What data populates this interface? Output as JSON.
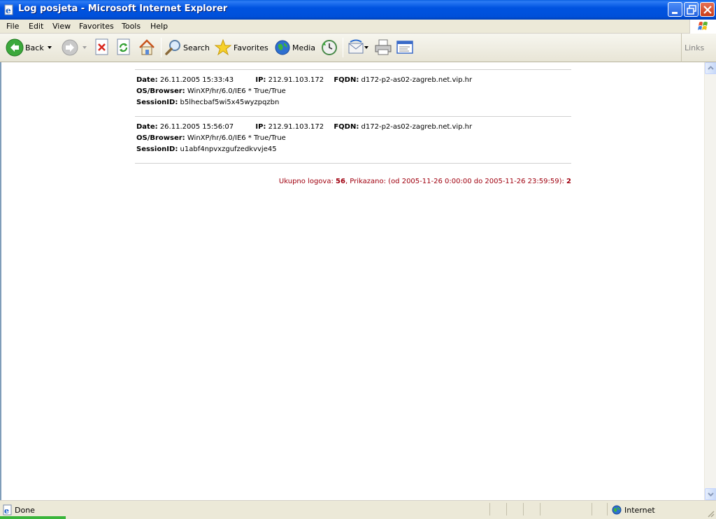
{
  "window": {
    "title": "Log posjeta - Microsoft Internet Explorer"
  },
  "menu": [
    "File",
    "Edit",
    "View",
    "Favorites",
    "Tools",
    "Help"
  ],
  "toolbar": {
    "back_label": "Back",
    "search_label": "Search",
    "favorites_label": "Favorites",
    "media_label": "Media",
    "links_label": "Links"
  },
  "labels": {
    "date": "Date:",
    "ip": "IP:",
    "fqdn": "FQDN:",
    "os_browser": "OS/Browser:",
    "session": "SessionID:"
  },
  "entries": [
    {
      "date": "26.11.2005 15:33:43",
      "ip": "212.91.103.172",
      "fqdn": "d172-p2-as02-zagreb.net.vip.hr",
      "os_browser": "WinXP/hr/6.0/IE6 * True/True",
      "session": "b5lhecbaf5wi5x45wyzpqzbn"
    },
    {
      "date": "26.11.2005 15:56:07",
      "ip": "212.91.103.172",
      "fqdn": "d172-p2-as02-zagreb.net.vip.hr",
      "os_browser": "WinXP/hr/6.0/IE6 * True/True",
      "session": "u1abf4npvxzgufzedkvvje45"
    }
  ],
  "summary": {
    "total_prefix": "Ukupno logova: ",
    "total": "56",
    "shown_prefix": ", Prikazano: (od 2005-11-26 0:00:00 do 2005-11-26 23:59:59): ",
    "shown": "2"
  },
  "status": {
    "text": "Done",
    "zone": "Internet"
  },
  "colors": {
    "titlebar": "#0053E0",
    "summary_text": "#A0000F"
  }
}
